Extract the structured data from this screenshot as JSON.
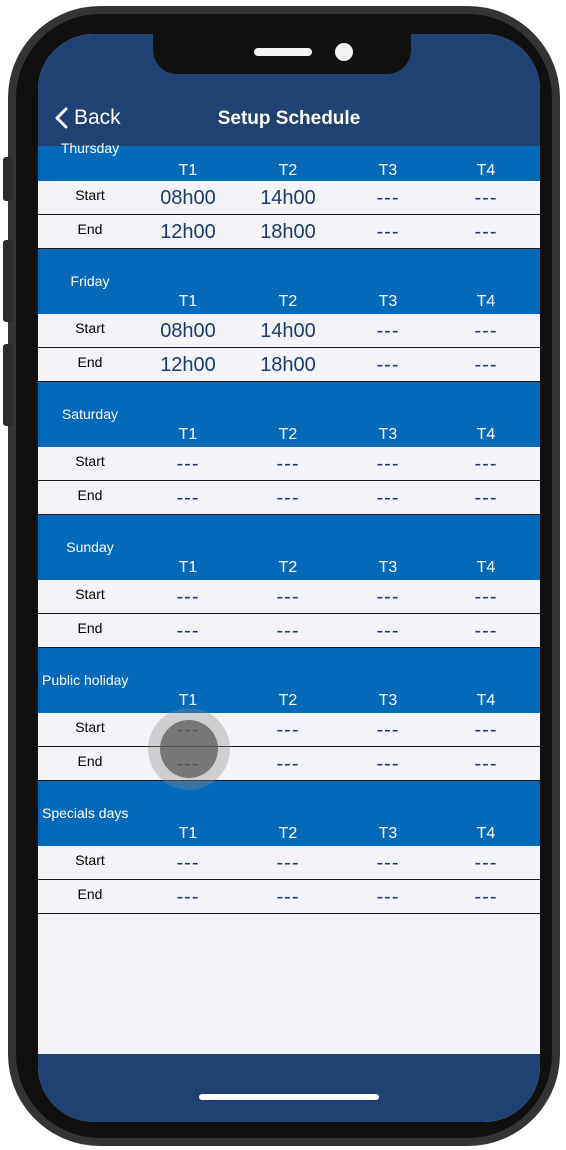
{
  "header": {
    "back_label": "Back",
    "title": "Setup Schedule"
  },
  "columns": [
    "T1",
    "T2",
    "T3",
    "T4"
  ],
  "row_labels": {
    "start": "Start",
    "end": "End"
  },
  "days": [
    {
      "name": "Thursday",
      "start": [
        "08h00",
        "14h00",
        "---",
        "---"
      ],
      "end": [
        "12h00",
        "18h00",
        "---",
        "---"
      ]
    },
    {
      "name": "Friday",
      "start": [
        "08h00",
        "14h00",
        "---",
        "---"
      ],
      "end": [
        "12h00",
        "18h00",
        "---",
        "---"
      ]
    },
    {
      "name": "Saturday",
      "start": [
        "---",
        "---",
        "---",
        "---"
      ],
      "end": [
        "---",
        "---",
        "---",
        "---"
      ]
    },
    {
      "name": "Sunday",
      "start": [
        "---",
        "---",
        "---",
        "---"
      ],
      "end": [
        "---",
        "---",
        "---",
        "---"
      ]
    },
    {
      "name": "Public holiday",
      "start": [
        "---",
        "---",
        "---",
        "---"
      ],
      "end": [
        "---",
        "---",
        "---",
        "---"
      ]
    },
    {
      "name": "Specials days",
      "start": [
        "---",
        "---",
        "---",
        "---"
      ],
      "end": [
        "---",
        "---",
        "---",
        "---"
      ]
    }
  ],
  "colors": {
    "nav": "#1f4272",
    "day_header": "#0369b8",
    "background": "#f3f3f8"
  }
}
